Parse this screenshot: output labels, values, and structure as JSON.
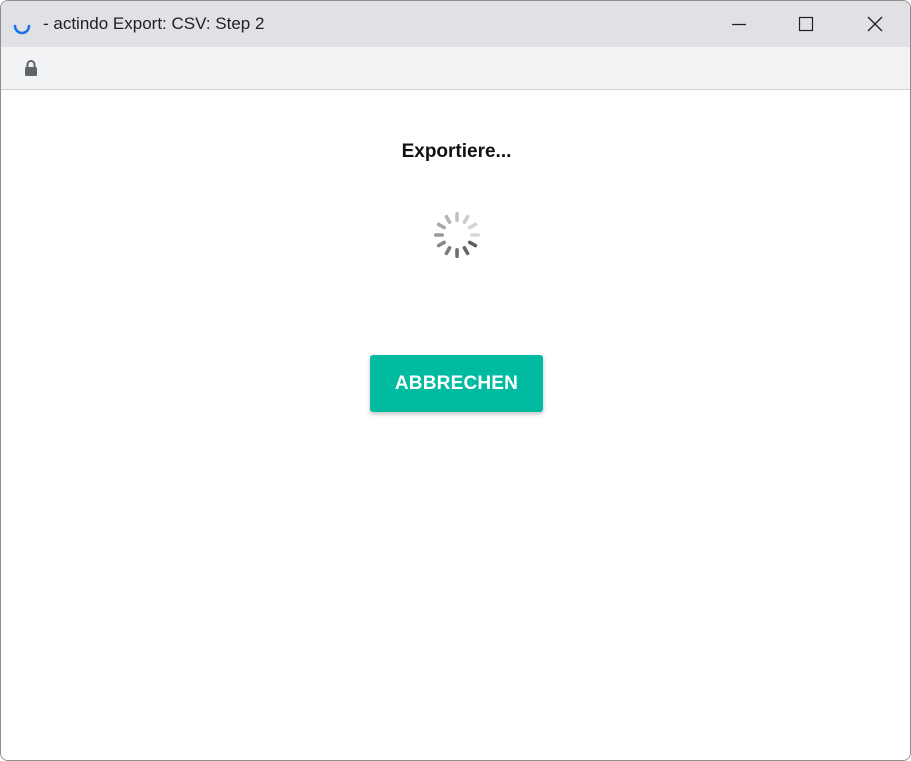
{
  "window": {
    "title": "- actindo Export: CSV: Step 2",
    "controls": {
      "minimize_icon": "minimize-icon",
      "maximize_icon": "maximize-icon",
      "close_icon": "close-icon"
    }
  },
  "addressbar": {
    "icon": "lock-icon"
  },
  "main": {
    "heading": "Exportiere...",
    "spinner_icon": "loading-spinner-icon",
    "cancel_label": "ABBRECHEN"
  },
  "colors": {
    "accent": "#00bb9f",
    "title_spinner": "#1a73e8",
    "titlebar_bg": "#dfe1e5",
    "addressbar_bg": "#f1f3f4"
  }
}
